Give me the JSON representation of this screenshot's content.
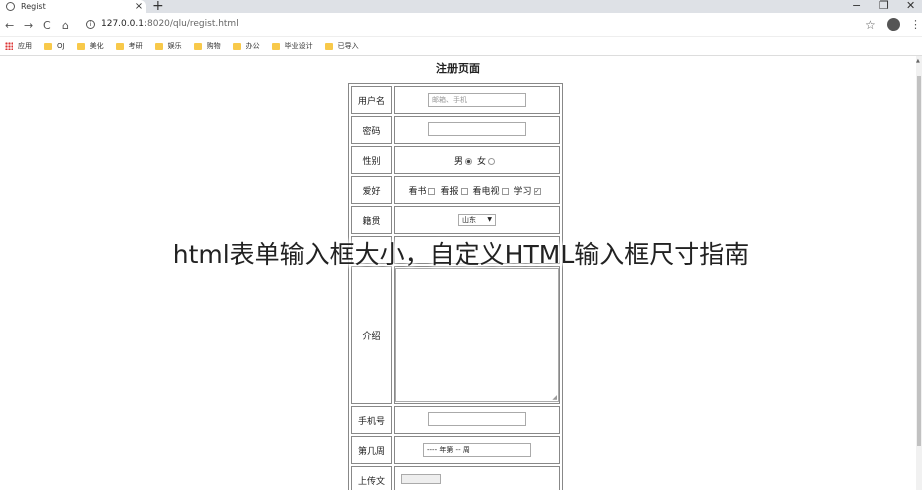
{
  "browser": {
    "tab_title": "Regist",
    "tab_close": "×",
    "new_tab": "+",
    "url_host": "127.0.0.1",
    "url_path": ":8020/qlu/regist.html",
    "window_controls": {
      "minimize": "−",
      "restore": "❐",
      "close": "✕"
    },
    "nav": {
      "back": "←",
      "forward": "→",
      "reload": "C",
      "home": "⌂"
    },
    "star": "☆",
    "kebab": "⋮"
  },
  "bookmarks": [
    {
      "label": "应用",
      "icon": "apps-grid-icon"
    },
    {
      "label": "OJ",
      "icon": "folder-icon"
    },
    {
      "label": "美化",
      "icon": "folder-icon"
    },
    {
      "label": "考研",
      "icon": "folder-icon"
    },
    {
      "label": "娱乐",
      "icon": "folder-icon"
    },
    {
      "label": "购物",
      "icon": "folder-icon"
    },
    {
      "label": "办公",
      "icon": "folder-icon"
    },
    {
      "label": "毕业设计",
      "icon": "folder-icon"
    },
    {
      "label": "已导入",
      "icon": "folder-icon"
    }
  ],
  "page": {
    "title": "注册页面",
    "fields": {
      "username_label": "用户名",
      "username_placeholder": "邮箱、手机",
      "password_label": "密码",
      "gender_label": "性别",
      "gender_male": "男",
      "gender_female": "女",
      "hobby_label": "爱好",
      "hobby_options": [
        "看书",
        "看报",
        "看电视",
        "学习"
      ],
      "hobby_checked": [
        false,
        false,
        false,
        true
      ],
      "native_label": "籍贯",
      "native_value": "山东",
      "intro_label": "介绍",
      "phone_label": "手机号",
      "week_label": "第几周",
      "week_value": "---- 年第 -- 周",
      "upload_label": "上传文"
    }
  },
  "overlay_title": "html表单输入框大小，自定义HTML输入框尺寸指南"
}
